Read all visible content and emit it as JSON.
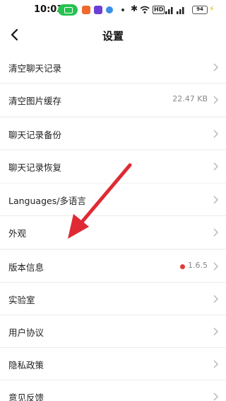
{
  "status_bar": {
    "time": "10:03",
    "battery": "94",
    "icons": [
      "phone-pill-icon",
      "app-icon-orange",
      "app-icon-purple",
      "app-icon-blue",
      "dot-icon",
      "bluetooth-icon",
      "wifi-icon",
      "hd-icon",
      "signal-icon",
      "battery-icon",
      "charging-icon"
    ],
    "hd_label": "HD"
  },
  "header": {
    "title": "设置",
    "back_icon": "chevron-left-icon"
  },
  "groups": [
    {
      "items": [
        {
          "label": "清空聊天记录",
          "value": ""
        },
        {
          "label": "清空图片缓存",
          "value": "22.47 KB"
        }
      ]
    },
    {
      "items": [
        {
          "label": "聊天记录备份",
          "value": ""
        },
        {
          "label": "聊天记录恢复",
          "value": ""
        }
      ]
    },
    {
      "items": [
        {
          "label": "Languages/多语言",
          "value": ""
        },
        {
          "label": "外观",
          "value": ""
        }
      ]
    },
    {
      "items": [
        {
          "label": "版本信息",
          "value": "1.6.5",
          "badge": "red-dot"
        },
        {
          "label": "实验室",
          "value": ""
        },
        {
          "label": "用户协议",
          "value": ""
        },
        {
          "label": "隐私政策",
          "value": ""
        },
        {
          "label": "意见反馈",
          "value": ""
        }
      ]
    }
  ],
  "annotation": {
    "arrow_color": "#e02a33",
    "points_to": "外观"
  },
  "colors": {
    "background": "#f2f2f2",
    "row_bg": "#ffffff",
    "text": "#222222",
    "muted": "#888888",
    "badge": "#e03b3b"
  }
}
